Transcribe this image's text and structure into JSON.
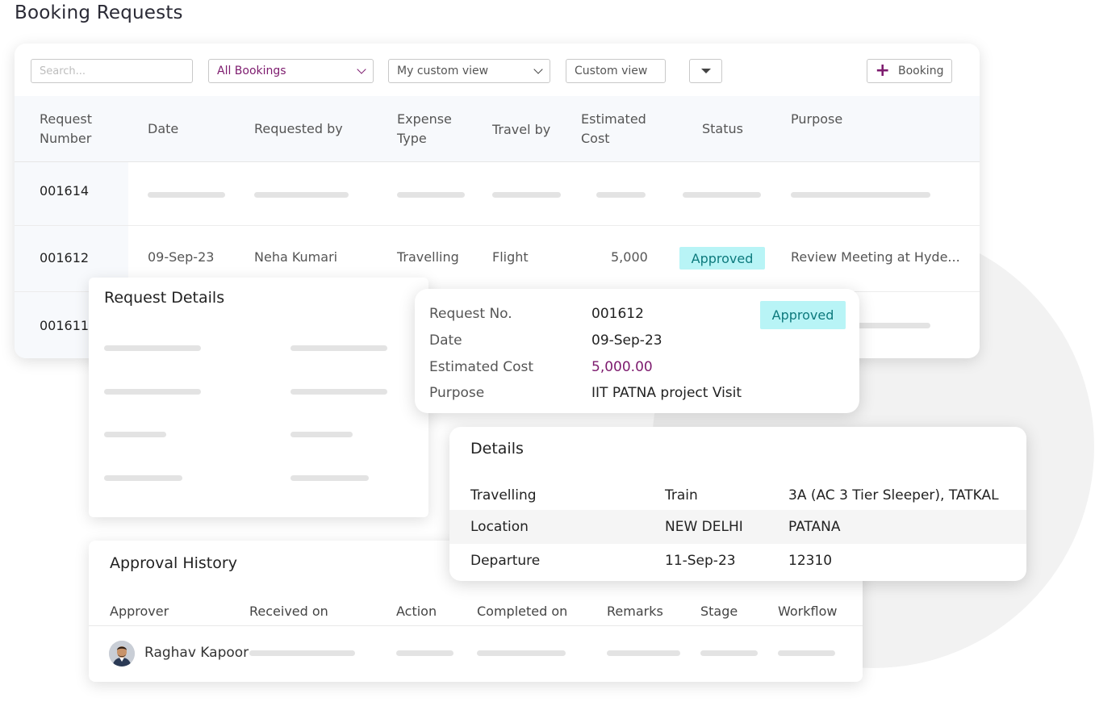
{
  "page": {
    "title": "Booking Requests"
  },
  "toolbar": {
    "search_placeholder": "Search...",
    "filter_selected": "All Bookings",
    "view_selected": "My custom view",
    "custom_view": "Custom view",
    "booking_button": "Booking"
  },
  "table": {
    "headers": {
      "request_number": [
        "Request",
        "Number"
      ],
      "date": "Date",
      "requested_by": "Requested by",
      "expense_type": [
        "Expense",
        "Type"
      ],
      "travel_by": "Travel by",
      "estimated_cost": [
        "Estimated",
        "Cost"
      ],
      "status": "Status",
      "purpose": "Purpose"
    },
    "rows": [
      {
        "number": "001614"
      },
      {
        "number": "001612",
        "date": "09-Sep-23",
        "requested_by": "Neha Kumari",
        "expense_type": "Travelling",
        "travel_by": "Flight",
        "estimated_cost": "5,000",
        "status": "Approved",
        "purpose": "Review Meeting at Hyde..."
      },
      {
        "number": "001611"
      }
    ]
  },
  "request_details": {
    "title": "Request Details"
  },
  "popup": {
    "request_no_label": "Request No.",
    "request_no": "001612",
    "date_label": "Date",
    "date": "09-Sep-23",
    "cost_label": "Estimated Cost",
    "cost": "5,000.00",
    "purpose_label": "Purpose",
    "purpose": "IIT PATNA project Visit",
    "status": "Approved"
  },
  "details": {
    "title": "Details",
    "rows": [
      {
        "label": "Travelling",
        "col2": "Train",
        "col3": "3A (AC 3 Tier Sleeper), TATKAL"
      },
      {
        "label": "Location",
        "col2": "NEW DELHI",
        "col3": "PATANA"
      },
      {
        "label": "Departure",
        "col2": "11-Sep-23",
        "col3": "12310"
      }
    ]
  },
  "approval_history": {
    "title": "Approval History",
    "headers": [
      "Approver",
      "Received on",
      "Action",
      "Completed on",
      "Remarks",
      "Stage",
      "Workflow"
    ],
    "approver": "Raghav Kapoor"
  },
  "colors": {
    "brand": "#7d1b6e",
    "approved_bg": "#b8f4f6",
    "approved_text": "#0d7a7d"
  }
}
